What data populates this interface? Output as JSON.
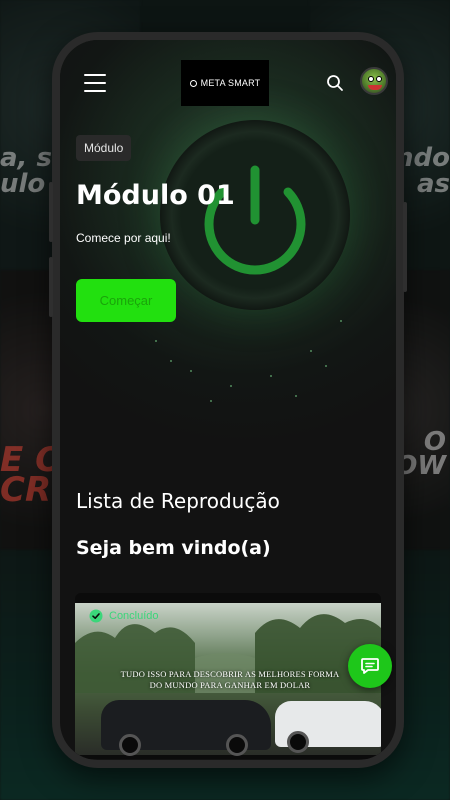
{
  "background": {
    "words": [
      "a, sou\nulo Co",
      "ando\nas",
      "E OF\nCR",
      "O\nOW"
    ]
  },
  "header": {
    "logo_text": "META SMART",
    "menu_icon": "hamburger-icon",
    "search_icon": "search-icon",
    "avatar_icon": "frog-avatar"
  },
  "hero": {
    "badge": "Módulo",
    "title": "Módulo 01",
    "subtitle": "Comece por aqui!",
    "cta_label": "Começar",
    "accent_color": "#22e00f"
  },
  "playlist": {
    "title": "Lista de Reprodução",
    "subtitle": "Seja bem vindo(a)"
  },
  "card": {
    "status": "Concluído",
    "status_color": "#3bd67a",
    "caption": "TUDO ISSO PARA DESCOBRIR AS MELHORES FORMA\nDO MUNDO PARA GANHAR EM DOLAR"
  },
  "chat": {
    "icon": "chat-icon",
    "color": "#1ec71a"
  }
}
